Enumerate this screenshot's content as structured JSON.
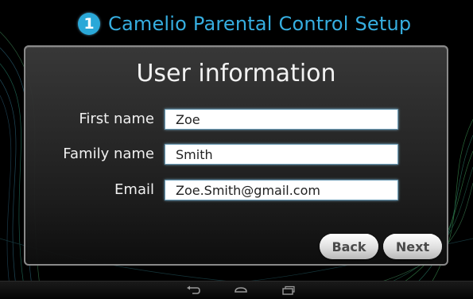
{
  "header": {
    "step_number": "1",
    "title": "Camelio Parental Control Setup"
  },
  "form": {
    "title": "User information",
    "fields": [
      {
        "label": "First name",
        "value": "Zoe"
      },
      {
        "label": "Family name",
        "value": "Smith"
      },
      {
        "label": "Email",
        "value": "Zoe.Smith@gmail.com"
      }
    ]
  },
  "buttons": {
    "back": "Back",
    "next": "Next"
  },
  "navbar": {
    "icons": [
      "back-icon",
      "home-icon",
      "recent-apps-icon"
    ]
  },
  "colors": {
    "accent": "#36aee0",
    "background": "#000000",
    "panel": "#2e2e2e"
  }
}
